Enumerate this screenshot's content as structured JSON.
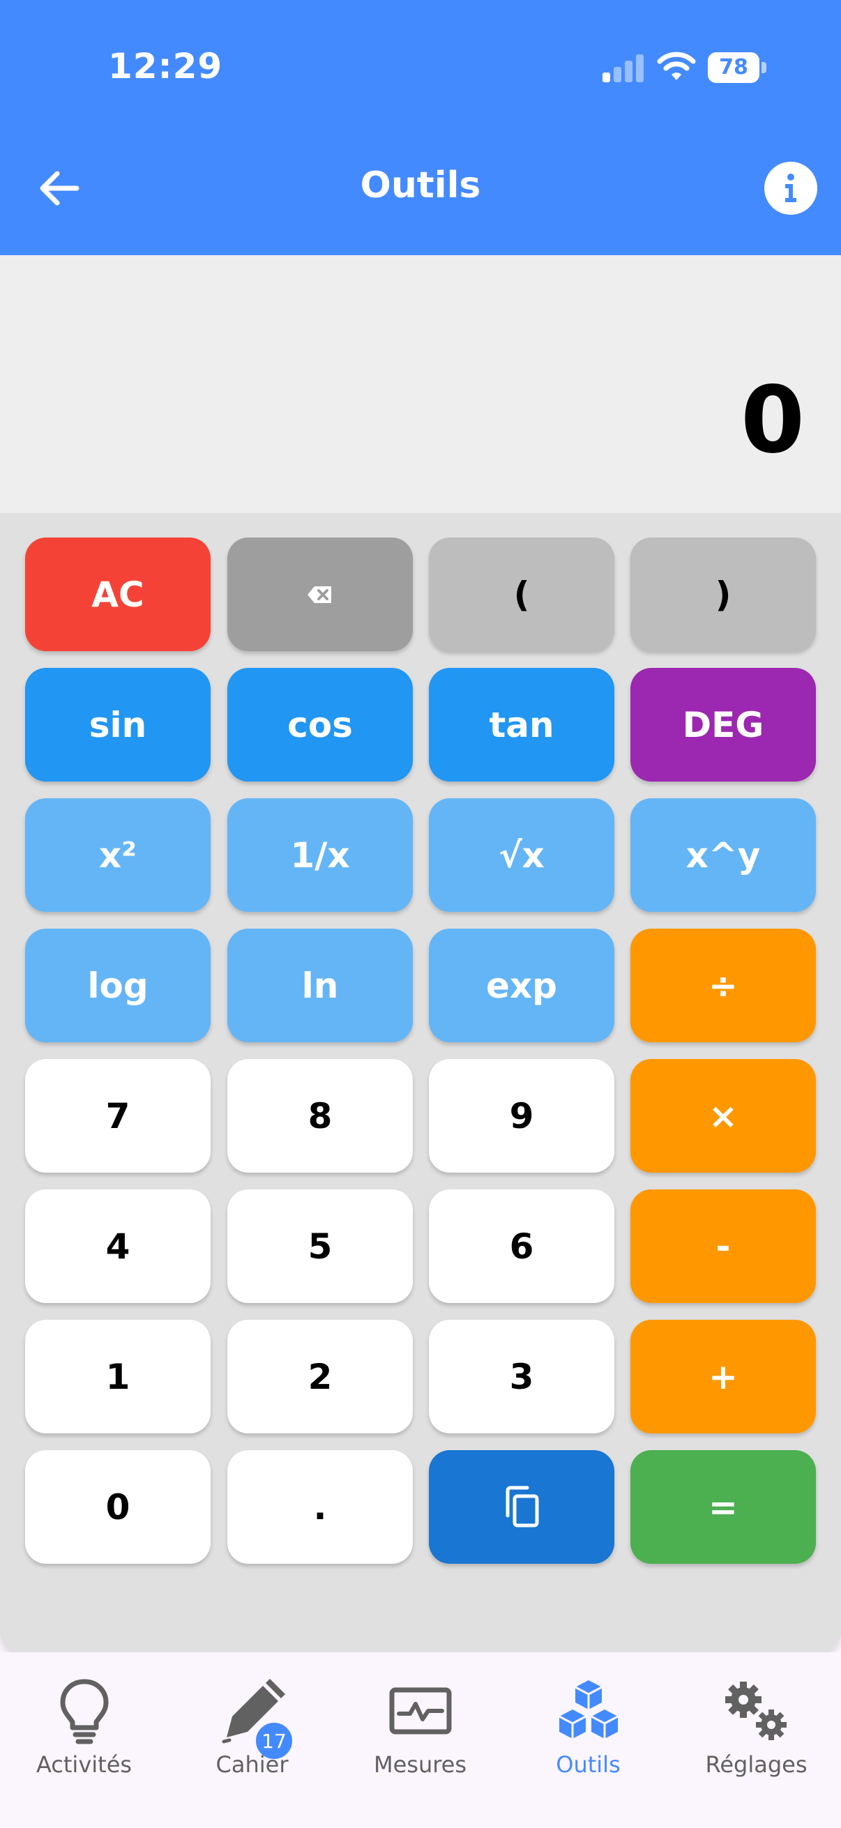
{
  "status_bar": {
    "time": "12:29",
    "battery": "78"
  },
  "header": {
    "title": "Outils"
  },
  "display": {
    "value": "0"
  },
  "keys": {
    "ac": "AC",
    "open_paren": "(",
    "close_paren": ")",
    "sin": "sin",
    "cos": "cos",
    "tan": "tan",
    "mode": "DEG",
    "square": "x²",
    "reciprocal": "1/x",
    "sqrt": "√x",
    "power": "x^y",
    "log": "log",
    "ln": "ln",
    "exp": "exp",
    "divide": "÷",
    "seven": "7",
    "eight": "8",
    "nine": "9",
    "multiply": "×",
    "four": "4",
    "five": "5",
    "six": "6",
    "minus": "-",
    "one": "1",
    "two": "2",
    "three": "3",
    "plus": "+",
    "zero": "0",
    "dot": ".",
    "equals": "="
  },
  "bottom_nav": {
    "items": [
      {
        "label": "Activités",
        "icon": "lightbulb-icon"
      },
      {
        "label": "Cahier",
        "icon": "notebook-pen-icon",
        "badge": "17"
      },
      {
        "label": "Mesures",
        "icon": "monitor-pulse-icon"
      },
      {
        "label": "Outils",
        "icon": "cubes-icon",
        "active": true
      },
      {
        "label": "Réglages",
        "icon": "gears-icon"
      }
    ]
  },
  "colors": {
    "primary": "#448aff",
    "clear": "#f44336",
    "function": "#2196f3",
    "mode": "#9c27b0",
    "scientific": "#64b5f6",
    "operator": "#ff9800",
    "equals": "#4caf50",
    "copy": "#1976d2"
  }
}
